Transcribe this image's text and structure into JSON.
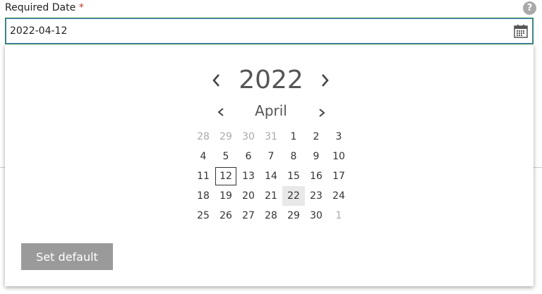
{
  "field": {
    "label": "Required Date",
    "required_marker": "*",
    "help_symbol": "?",
    "value": "2022-04-12"
  },
  "calendar": {
    "year": "2022",
    "month": "April",
    "days": [
      {
        "d": "28",
        "other": true
      },
      {
        "d": "29",
        "other": true
      },
      {
        "d": "30",
        "other": true
      },
      {
        "d": "31",
        "other": true
      },
      {
        "d": "1"
      },
      {
        "d": "2"
      },
      {
        "d": "3"
      },
      {
        "d": "4"
      },
      {
        "d": "5"
      },
      {
        "d": "6"
      },
      {
        "d": "7"
      },
      {
        "d": "8"
      },
      {
        "d": "9"
      },
      {
        "d": "10"
      },
      {
        "d": "11"
      },
      {
        "d": "12",
        "selected": true
      },
      {
        "d": "13"
      },
      {
        "d": "14"
      },
      {
        "d": "15"
      },
      {
        "d": "16"
      },
      {
        "d": "17"
      },
      {
        "d": "18"
      },
      {
        "d": "19"
      },
      {
        "d": "20"
      },
      {
        "d": "21"
      },
      {
        "d": "22",
        "today": true
      },
      {
        "d": "23"
      },
      {
        "d": "24"
      },
      {
        "d": "25"
      },
      {
        "d": "26"
      },
      {
        "d": "27"
      },
      {
        "d": "28"
      },
      {
        "d": "29"
      },
      {
        "d": "30"
      },
      {
        "d": "1",
        "other": true
      }
    ]
  },
  "actions": {
    "set_default_label": "Set default"
  },
  "icons": {
    "help": "help-icon",
    "calendar": "calendar-icon",
    "prev": "chevron-left-icon",
    "next": "chevron-right-icon"
  },
  "colors": {
    "focus_border": "#2d8a3d",
    "focus_inner": "#4a7fd8",
    "required": "#c0392b",
    "button_bg": "#9a9a9a"
  }
}
